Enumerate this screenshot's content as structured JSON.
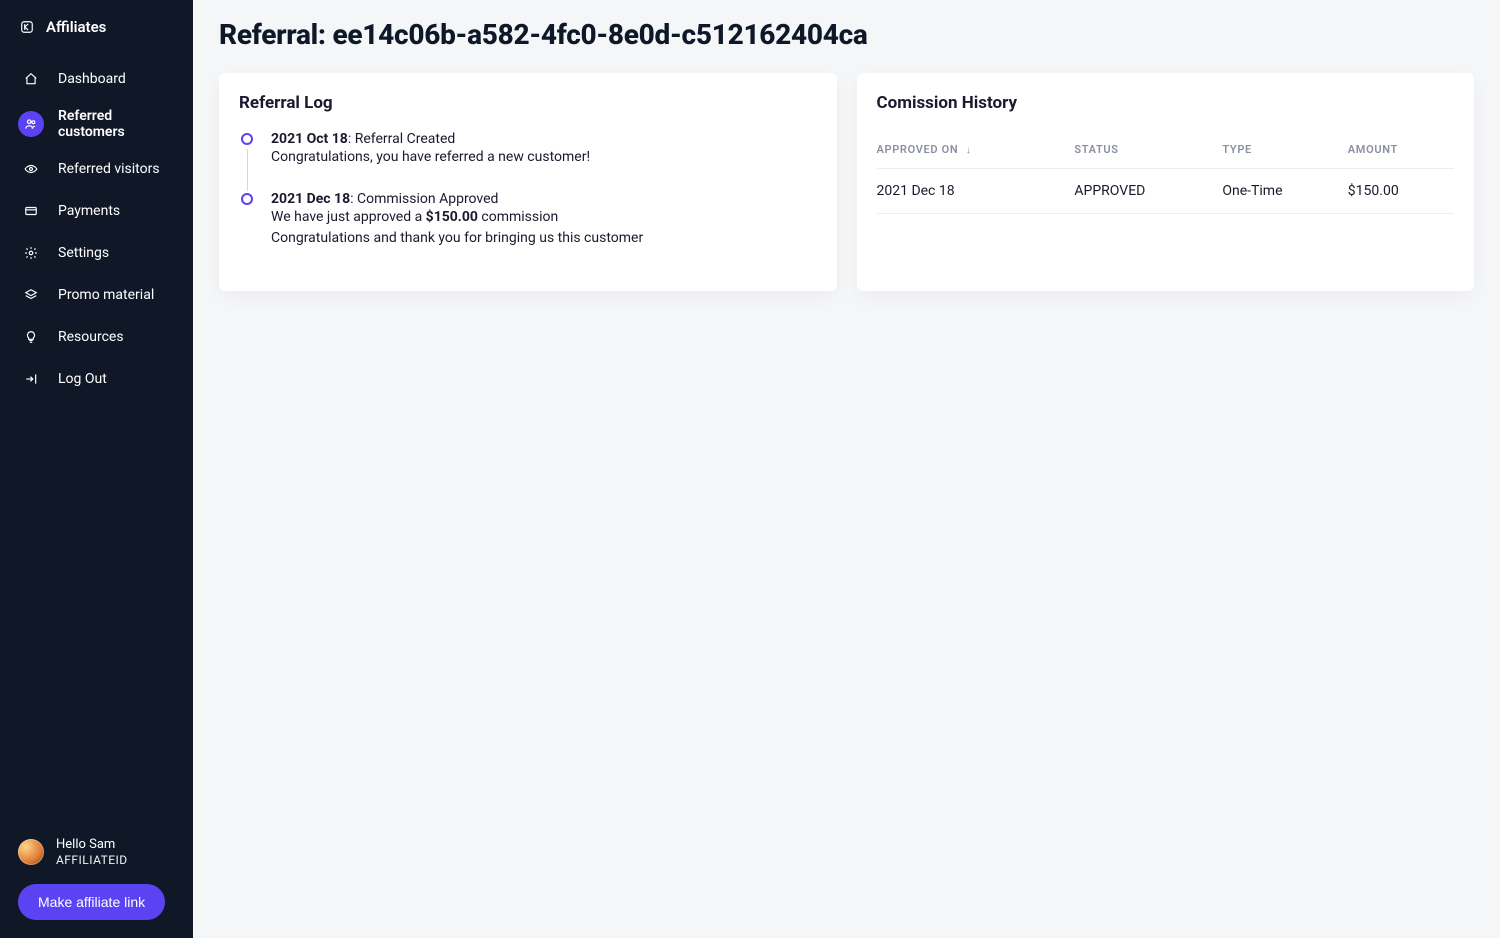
{
  "brand": {
    "label": "Affiliates"
  },
  "sidebar": {
    "items": [
      {
        "label": "Dashboard",
        "icon": "home",
        "active": false
      },
      {
        "label": "Referred customers",
        "icon": "users",
        "active": true
      },
      {
        "label": "Referred visitors",
        "icon": "eye",
        "active": false
      },
      {
        "label": "Payments",
        "icon": "credit-card",
        "active": false
      },
      {
        "label": "Settings",
        "icon": "gear",
        "active": false
      },
      {
        "label": "Promo material",
        "icon": "layers",
        "active": false
      },
      {
        "label": "Resources",
        "icon": "lightbulb",
        "active": false
      },
      {
        "label": "Log Out",
        "icon": "logout",
        "active": false
      }
    ],
    "user": {
      "greeting": "Hello Sam",
      "id": "AFFILIATEID"
    },
    "cta_label": "Make affiliate link"
  },
  "page": {
    "title": "Referral: ee14c06b-a582-4fc0-8e0d-c512162404ca"
  },
  "referral_log": {
    "card_title": "Referral Log",
    "entries": [
      {
        "date": "2021 Oct 18",
        "headline": "Referral Created",
        "body_plain": "Congratulations, you have referred a new customer!"
      },
      {
        "date": "2021 Dec 18",
        "headline": "Commission Approved",
        "body_pre": "We have just approved a ",
        "body_amount": "$150.00",
        "body_post": " commission",
        "body_line2": "Congratulations and thank you for bringing us this customer"
      }
    ]
  },
  "commission_history": {
    "card_title": "Comission History",
    "columns": {
      "approved_on": "APPROVED ON",
      "status": "STATUS",
      "type": "TYPE",
      "amount": "AMOUNT"
    },
    "rows": [
      {
        "approved_on": "2021 Dec 18",
        "status": "APPROVED",
        "type": "One-Time",
        "amount": "$150.00"
      }
    ]
  },
  "colors": {
    "accent": "#5b42f3",
    "sidebar_bg": "#101828"
  }
}
